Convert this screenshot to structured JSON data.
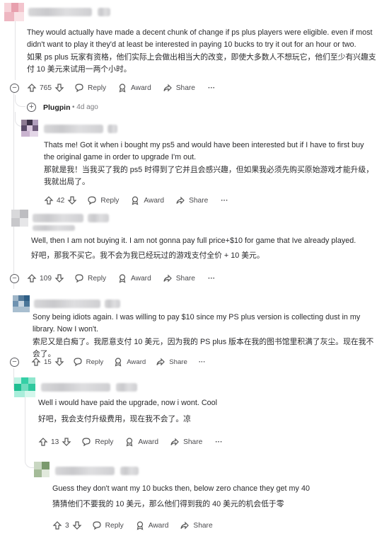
{
  "comments": [
    {
      "text_en": "They would actually have made a decent chunk of change if ps plus players were eligible. even if most didn't want to play it they'd at least be interested in paying 10 bucks to try it out for an hour or two.",
      "text_zh": "如果 ps plus 玩家有资格，他们实际上会做出相当大的改变，即使大多数人不想玩它，他们至少有兴趣支付 10 美元来试用一两个小时。",
      "votes": "765"
    },
    {
      "text_en": "Thats me! Got it when i bought my ps5 and would have been interested but if I have to first buy the original game in order to upgrade I'm out.",
      "text_zh": "那就是我！当我买了我的 ps5 时得到了它并且会感兴趣，但如果我必须先购买原始游戏才能升级，我就出局了。",
      "votes": "42"
    },
    {
      "text_en": "Well, then I am not buying it. I am not gonna pay full price+$10 for game that Ive already played.",
      "text_zh": "好吧，那我不买它。我不会为我已经玩过的游戏支付全价 + 10 美元。",
      "votes": "109"
    },
    {
      "text_en": "Sony being idiots again. I was willing to pay $10 since my PS plus version is collecting dust in my library. Now I won't.",
      "text_zh": "索尼又是白痴了。我愿意支付 10 美元，因为我的 PS plus 版本在我的图书馆里积满了灰尘。现在我不会了。",
      "votes": "15"
    },
    {
      "text_en": "Well i would have paid the upgrade, now i wont. Cool",
      "text_zh": "好吧，我会支付升级费用，现在我不会了。凉",
      "votes": "13"
    },
    {
      "text_en": "Guess they don't want my 10 bucks then, below zero chance they get my 40",
      "text_zh": "猜猜他们不要我的 10 美元，那么他们得到我的 40 美元的机会低于零",
      "votes": "3"
    }
  ],
  "labels": {
    "reply": "Reply",
    "award": "Award",
    "share": "Share",
    "more": "···"
  },
  "collapsed": {
    "username": "Plugpin",
    "time": "4d ago"
  },
  "icons": [
    "collapse-icon",
    "expand-icon",
    "upvote-icon",
    "downvote-icon",
    "reply-icon",
    "award-icon",
    "share-icon",
    "more-icon"
  ],
  "colors": {
    "thread": "#e3e3e6",
    "text": "#2a2a2c",
    "meta": "#4a4a4d"
  }
}
